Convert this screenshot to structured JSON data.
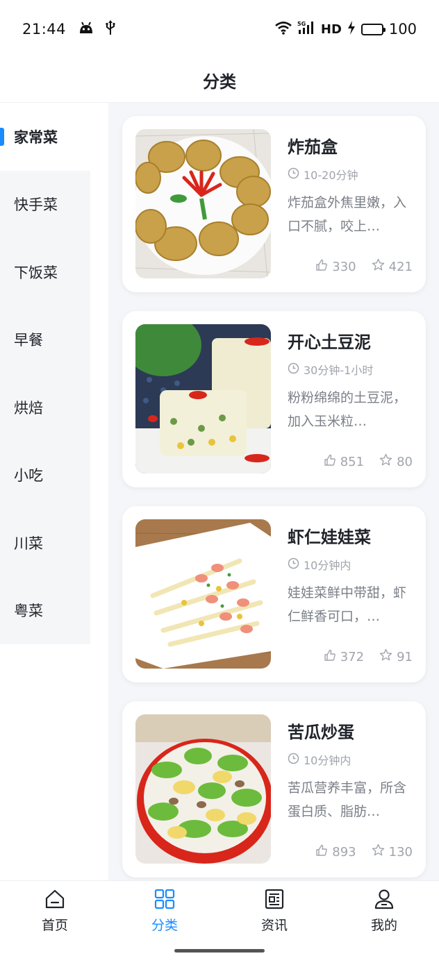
{
  "status_bar": {
    "time": "21:44",
    "network": "HD",
    "battery": "100",
    "icons": [
      "android-debug-icon",
      "usb-icon",
      "wifi-icon",
      "5g-signal-icon",
      "charging-icon",
      "battery-icon"
    ]
  },
  "header": {
    "title": "分类"
  },
  "sidebar": {
    "items": [
      {
        "label": "家常菜",
        "active": true
      },
      {
        "label": "快手菜"
      },
      {
        "label": "下饭菜"
      },
      {
        "label": "早餐"
      },
      {
        "label": "烘焙"
      },
      {
        "label": "小吃"
      },
      {
        "label": "川菜"
      },
      {
        "label": "粤菜"
      }
    ]
  },
  "recipes": [
    {
      "title": "炸茄盒",
      "time": "10-20分钟",
      "desc": "炸茄盒外焦里嫩，入口不腻，咬上…",
      "likes": "330",
      "stars": "421"
    },
    {
      "title": "开心土豆泥",
      "time": "30分钟-1小时",
      "desc": "粉粉绵绵的土豆泥，加入玉米粒…",
      "likes": "851",
      "stars": "80"
    },
    {
      "title": "虾仁娃娃菜",
      "time": "10分钟内",
      "desc": "娃娃菜鲜中带甜，虾仁鲜香可口，…",
      "likes": "372",
      "stars": "91"
    },
    {
      "title": "苦瓜炒蛋",
      "time": "10分钟内",
      "desc": "苦瓜营养丰富，所含蛋白质、脂肪…",
      "likes": "893",
      "stars": "130"
    }
  ],
  "bottom_nav": {
    "items": [
      {
        "label": "首页",
        "icon": "home-icon"
      },
      {
        "label": "分类",
        "icon": "category-icon",
        "active": true
      },
      {
        "label": "资讯",
        "icon": "news-icon"
      },
      {
        "label": "我的",
        "icon": "profile-icon"
      }
    ]
  },
  "colors": {
    "accent": "#1a8cff",
    "text": "#1f2329",
    "muted": "#a0a4ab",
    "content_bg": "#f4f6f9",
    "sidebar_bg": "#f5f6f8"
  }
}
